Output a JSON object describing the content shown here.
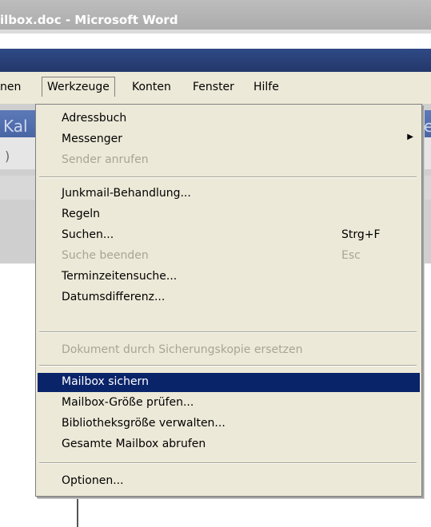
{
  "window": {
    "title": "ilbox.doc - Microsoft Word"
  },
  "background": {
    "partial_text_left": "Kal",
    "partial_text_right": "e",
    "toolbar_fragment": ")"
  },
  "menubar": {
    "items": [
      "nen",
      "Werkzeuge",
      "Konten",
      "Fenster",
      "Hilfe"
    ]
  },
  "menu": {
    "adressbuch": "Adressbuch",
    "messenger": "Messenger",
    "sender_anrufen": "Sender anrufen",
    "junkmail": "Junkmail-Behandlung...",
    "regeln": "Regeln",
    "suchen": "Suchen...",
    "suchen_shortcut": "Strg+F",
    "suche_beenden": "Suche beenden",
    "suche_beenden_shortcut": "Esc",
    "terminzeitensuche": "Terminzeitensuche...",
    "datumsdifferenz": "Datumsdifferenz...",
    "dokument_ersetzen": "Dokument durch Sicherungskopie ersetzen",
    "mailbox_sichern": "Mailbox sichern",
    "mailbox_groesse": "Mailbox-Größe prüfen...",
    "bibliotheksgroesse": "Bibliotheksgröße verwalten...",
    "gesamte_mailbox": "Gesamte Mailbox abrufen",
    "optionen": "Optionen..."
  },
  "colors": {
    "menu_background": "#ece9d8",
    "selection": "#0a246a",
    "disabled_text": "#a7a597",
    "title_bar": "#a9a9a9",
    "accent_band": "#23386b"
  }
}
